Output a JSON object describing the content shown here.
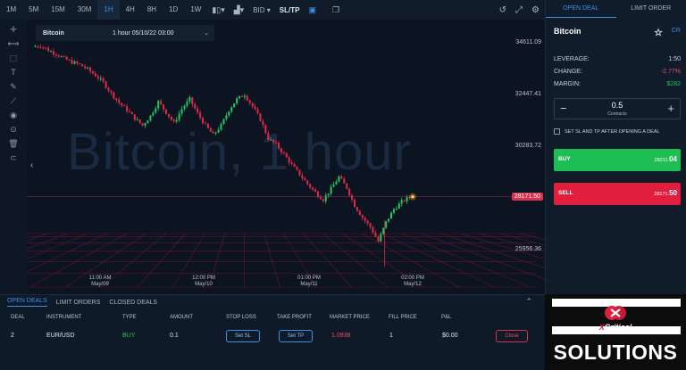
{
  "toolbar": {
    "timeframes": [
      "1M",
      "5M",
      "15M",
      "30M",
      "1H",
      "4H",
      "8H",
      "1D",
      "1W"
    ],
    "active_timeframe": "1H",
    "price_side": "BID",
    "sl_tp": "SL/TP"
  },
  "chart": {
    "symbol": "Bitcoin",
    "period_label": "1 hour 05/10/22 03:00",
    "watermark": "Bitcoin, 1 hour",
    "price_labels": [
      "34611.09",
      "32447.41",
      "30283.72",
      "25956.36"
    ],
    "current_price": "28171.50",
    "time_labels": [
      {
        "time": "11:00 AM",
        "date": "May/09"
      },
      {
        "time": "12:00 PM",
        "date": "May/10"
      },
      {
        "time": "01:00 PM",
        "date": "May/11"
      },
      {
        "time": "02:00 PM",
        "date": "May/12"
      }
    ],
    "colors": {
      "up": "#22c55e",
      "down": "#e0294a",
      "grid": "#8a1830"
    }
  },
  "chart_data": {
    "type": "candlestick",
    "title": "Bitcoin, 1 hour",
    "x_range": [
      "May/09",
      "May/12"
    ],
    "ylim": [
      25000,
      35000
    ],
    "close_path": [
      34450,
      34500,
      34300,
      34150,
      33950,
      33800,
      33700,
      33500,
      33250,
      32950,
      32500,
      32100,
      31800,
      31450,
      31150,
      31550,
      32150,
      31700,
      31250,
      31850,
      32250,
      31650,
      31150,
      30750,
      31150,
      31800,
      32250,
      32450,
      31950,
      31400,
      30600,
      30350,
      29950,
      29500,
      29100,
      28700,
      28350,
      28050,
      28500,
      29000,
      28550,
      27800,
      27300,
      26900,
      26300,
      27100,
      27650,
      27950,
      28171.5
    ],
    "last_price": 28171.5
  },
  "deals": {
    "tabs": [
      "OPEN DEALS",
      "LIMIT ORDERS",
      "CLOSED DEALS"
    ],
    "columns": [
      "DEAL",
      "INSTRUMENT",
      "TYPE",
      "AMOUNT",
      "STOP LOSS",
      "TAKE PROFIT",
      "MARKET PRICE",
      "FILL PRICE",
      "P&L"
    ],
    "row": {
      "deal": "2",
      "instrument": "EUR/USD",
      "type": "BUY",
      "amount": "0.1",
      "stop_loss_btn": "Set SL",
      "take_profit_btn": "Set TP",
      "market_price": "1.0938",
      "fill_price": "1",
      "pnl": "$0.00",
      "close_btn": "Close"
    }
  },
  "panel": {
    "tabs": [
      "OPEN DEAL",
      "LIMIT ORDER"
    ],
    "asset": "Bitcoin",
    "cr": "CR",
    "leverage_label": "LEVERAGE:",
    "leverage": "1:50",
    "change_label": "CHANGE:",
    "change": "-2.77%",
    "margin_label": "MARGIN:",
    "margin": "$282",
    "amount": "0.5",
    "amount_unit": "Contracts",
    "sltp_checkbox": "SET SL AND TP AFTER OPENING A DEAL",
    "buy_label": "BUY",
    "buy_price_main": "28211.",
    "buy_price_big": "04",
    "sell_label": "SELL",
    "sell_price_main": "28171.",
    "sell_price_big": "50"
  },
  "brand": {
    "name_x": "X",
    "name_rest": "Critical",
    "solutions": "SOLUTIONS"
  }
}
